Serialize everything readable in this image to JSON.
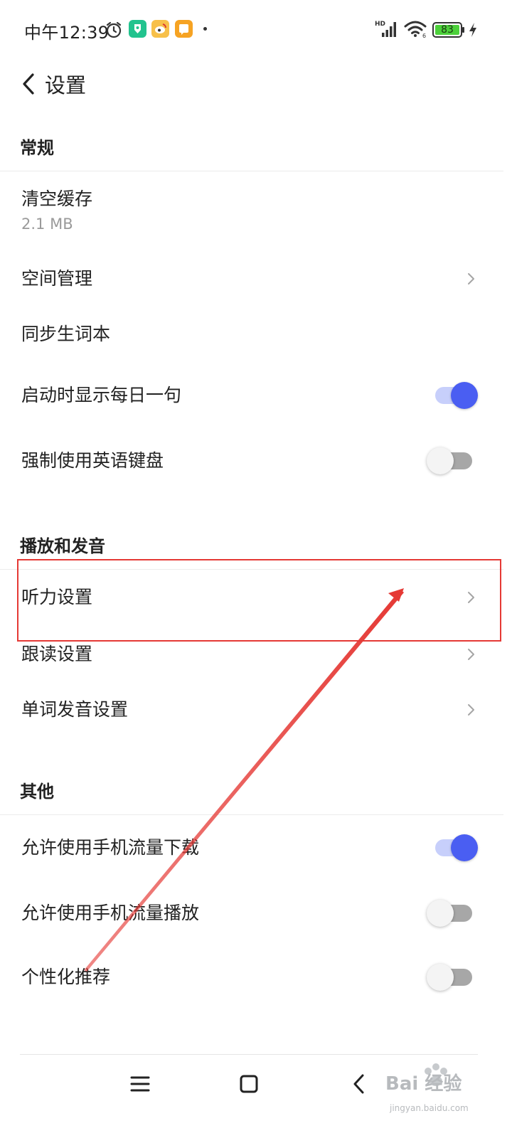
{
  "status_bar": {
    "time": "中午12:39",
    "network": "HD",
    "battery": "83"
  },
  "header": {
    "title": "设置"
  },
  "sections": {
    "general": {
      "title": "常规",
      "clear_cache": {
        "label": "清空缓存",
        "size": "2.1 MB"
      },
      "space_manage": {
        "label": "空间管理"
      },
      "sync_wordbook": {
        "label": "同步生词本"
      },
      "daily_sentence": {
        "label": "启动时显示每日一句",
        "enabled": true
      },
      "force_english_keyboard": {
        "label": "强制使用英语键盘",
        "enabled": false
      }
    },
    "playback": {
      "title": "播放和发音",
      "listening_settings": {
        "label": "听力设置"
      },
      "follow_read_settings": {
        "label": "跟读设置"
      },
      "word_pronunciation_settings": {
        "label": "单词发音设置"
      }
    },
    "other": {
      "title": "其他",
      "mobile_data_download": {
        "label": "允许使用手机流量下载",
        "enabled": true
      },
      "mobile_data_play": {
        "label": "允许使用手机流量播放",
        "enabled": false
      },
      "personalized_recommend": {
        "label": "个性化推荐",
        "enabled": false
      }
    }
  },
  "watermark": {
    "text": "Bai 经验",
    "url": "jingyan.baidu.com"
  },
  "colors": {
    "accent": "#4a5ef2",
    "toggle_track_on": "#c7cffb",
    "annotation_red": "#e53935"
  }
}
